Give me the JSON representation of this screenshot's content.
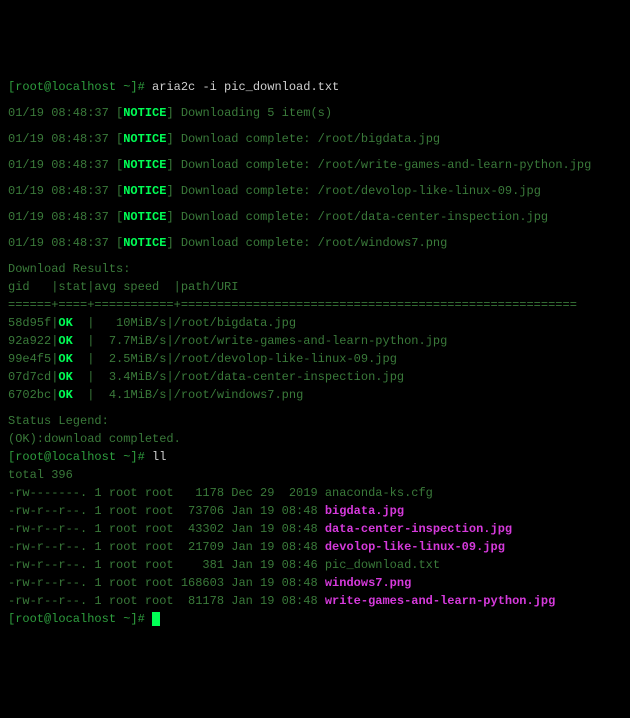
{
  "prompt": "[root@localhost ~]#",
  "cmd1": "aria2c -i pic_download.txt",
  "notice_label": "NOTICE",
  "logs": [
    {
      "ts": "01/19 08:48:37",
      "msg": "Downloading 5 item(s)"
    },
    {
      "ts": "01/19 08:48:37",
      "msg": "Download complete: /root/bigdata.jpg"
    },
    {
      "ts": "01/19 08:48:37",
      "msg": "Download complete: /root/write-games-and-learn-python.jpg"
    },
    {
      "ts": "01/19 08:48:37",
      "msg": "Download complete: /root/devolop-like-linux-09.jpg"
    },
    {
      "ts": "01/19 08:48:37",
      "msg": "Download complete: /root/data-center-inspection.jpg"
    },
    {
      "ts": "01/19 08:48:37",
      "msg": "Download complete: /root/windows7.png"
    }
  ],
  "results_header": "Download Results:",
  "results_cols": "gid   |stat|avg speed  |path/URI",
  "results_sep": "======+====+===========+=======================================================",
  "results": [
    {
      "gid": "58d95f",
      "stat": "OK",
      "speed": "   10MiB/s",
      "path": "/root/bigdata.jpg"
    },
    {
      "gid": "92a922",
      "stat": "OK",
      "speed": "  7.7MiB/s",
      "path": "/root/write-games-and-learn-python.jpg"
    },
    {
      "gid": "99e4f5",
      "stat": "OK",
      "speed": "  2.5MiB/s",
      "path": "/root/devolop-like-linux-09.jpg"
    },
    {
      "gid": "07d7cd",
      "stat": "OK",
      "speed": "  3.4MiB/s",
      "path": "/root/data-center-inspection.jpg"
    },
    {
      "gid": "6702bc",
      "stat": "OK",
      "speed": "  4.1MiB/s",
      "path": "/root/windows7.png"
    }
  ],
  "legend1": "Status Legend:",
  "legend2": "(OK):download completed.",
  "cmd2": "ll",
  "total": "total 396",
  "files": [
    {
      "perm": "-rw-------.",
      "n": "1",
      "own": "root root",
      "size": "  1178",
      "date": "Dec 29  2019",
      "name": "anaconda-ks.cfg",
      "hl": false
    },
    {
      "perm": "-rw-r--r--.",
      "n": "1",
      "own": "root root",
      "size": " 73706",
      "date": "Jan 19 08:48",
      "name": "bigdata.jpg",
      "hl": true
    },
    {
      "perm": "-rw-r--r--.",
      "n": "1",
      "own": "root root",
      "size": " 43302",
      "date": "Jan 19 08:48",
      "name": "data-center-inspection.jpg",
      "hl": true
    },
    {
      "perm": "-rw-r--r--.",
      "n": "1",
      "own": "root root",
      "size": " 21709",
      "date": "Jan 19 08:48",
      "name": "devolop-like-linux-09.jpg",
      "hl": true
    },
    {
      "perm": "-rw-r--r--.",
      "n": "1",
      "own": "root root",
      "size": "   381",
      "date": "Jan 19 08:46",
      "name": "pic_download.txt",
      "hl": false
    },
    {
      "perm": "-rw-r--r--.",
      "n": "1",
      "own": "root root",
      "size": "168603",
      "date": "Jan 19 08:48",
      "name": "windows7.png",
      "hl": true
    },
    {
      "perm": "-rw-r--r--.",
      "n": "1",
      "own": "root root",
      "size": " 81178",
      "date": "Jan 19 08:48",
      "name": "write-games-and-learn-python.jpg",
      "hl": true
    }
  ]
}
